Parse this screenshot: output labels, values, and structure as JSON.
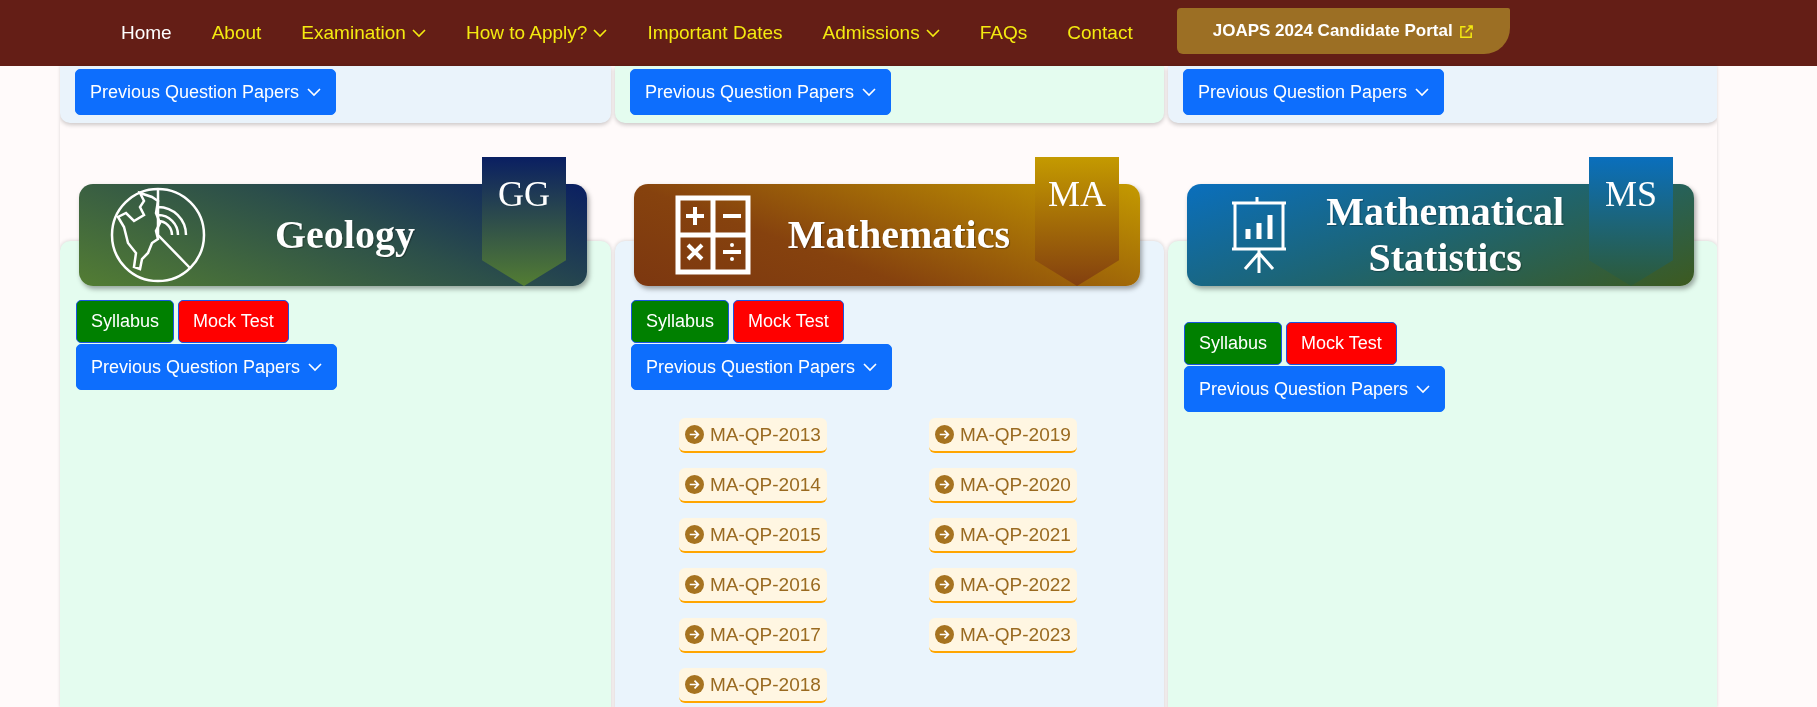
{
  "nav": {
    "items": [
      {
        "label": "Home",
        "selected": true,
        "dropdown": false
      },
      {
        "label": "About",
        "selected": false,
        "dropdown": false
      },
      {
        "label": "Examination",
        "selected": false,
        "dropdown": true
      },
      {
        "label": "How to Apply?",
        "selected": false,
        "dropdown": true
      },
      {
        "label": "Important Dates",
        "selected": false,
        "dropdown": false
      },
      {
        "label": "Admissions",
        "selected": false,
        "dropdown": true
      },
      {
        "label": "FAQs",
        "selected": false,
        "dropdown": false
      },
      {
        "label": "Contact",
        "selected": false,
        "dropdown": false
      }
    ],
    "portal": {
      "label": "JOAPS 2024 Candidate Portal"
    }
  },
  "top_cards": [
    {
      "button": "Previous Question Papers"
    },
    {
      "button": "Previous Question Papers"
    },
    {
      "button": "Previous Question Papers"
    }
  ],
  "subjects": [
    {
      "kind": "geology",
      "name": "Geology",
      "code": "GG",
      "syllabus": "Syllabus",
      "mock_test": "Mock Test",
      "papers_button": "Previous Question Papers"
    },
    {
      "kind": "mathematics",
      "name": "Mathematics",
      "code": "MA",
      "syllabus": "Syllabus",
      "mock_test": "Mock Test",
      "papers_button": "Previous Question Papers",
      "papers": [
        "MA-QP-2013",
        "MA-QP-2014",
        "MA-QP-2015",
        "MA-QP-2016",
        "MA-QP-2017",
        "MA-QP-2018",
        "MA-QP-2019",
        "MA-QP-2020",
        "MA-QP-2021",
        "MA-QP-2022",
        "MA-QP-2023"
      ]
    },
    {
      "kind": "statistics",
      "name": "Mathematical Statistics",
      "code": "MS",
      "syllabus": "Syllabus",
      "mock_test": "Mock Test",
      "papers_button": "Previous Question Papers"
    }
  ]
}
